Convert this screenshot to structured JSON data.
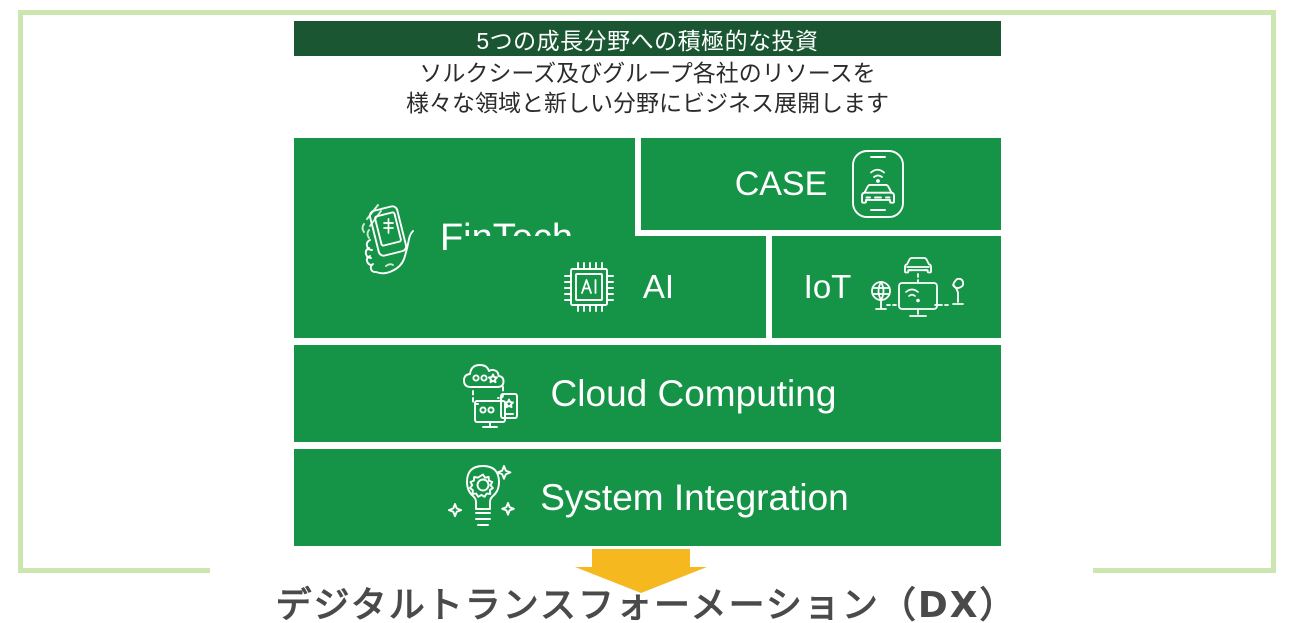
{
  "header": {
    "band_title": "5つの成長分野への積極的な投資",
    "subtitle_line1": "ソルクシーズ及びグループ各社のリソースを",
    "subtitle_line2": "様々な領域と新しい分野にビジネス展開します"
  },
  "blocks": [
    {
      "id": "fintech",
      "label": "FinTech",
      "icon": "hand-holding-smartphone-money-icon",
      "icon_side": "left"
    },
    {
      "id": "case",
      "label": "CASE",
      "icon": "smartphone-connected-car-icon",
      "icon_side": "right"
    },
    {
      "id": "ai",
      "label": "AI",
      "icon": "cpu-chip-ai-icon",
      "icon_side": "left"
    },
    {
      "id": "iot",
      "label": "IoT",
      "icon": "iot-connected-devices-icon",
      "icon_side": "right"
    },
    {
      "id": "cloud",
      "label": "Cloud Computing",
      "icon": "cloud-devices-icon",
      "icon_side": "left"
    },
    {
      "id": "si",
      "label": "System Integration",
      "icon": "lightbulb-gear-icon",
      "icon_side": "left"
    }
  ],
  "arrow": {
    "name": "down-arrow",
    "color": "#f5b81e"
  },
  "caption": {
    "text": "デジタルトランスフォーメーション（DX）"
  },
  "colors": {
    "header_band": "#1a5632",
    "block_green": "#159447",
    "frame_green": "#cde5ae",
    "arrow_yellow": "#f5b81e",
    "caption_gray": "#4a4a4a",
    "block_text": "#ffffff"
  }
}
